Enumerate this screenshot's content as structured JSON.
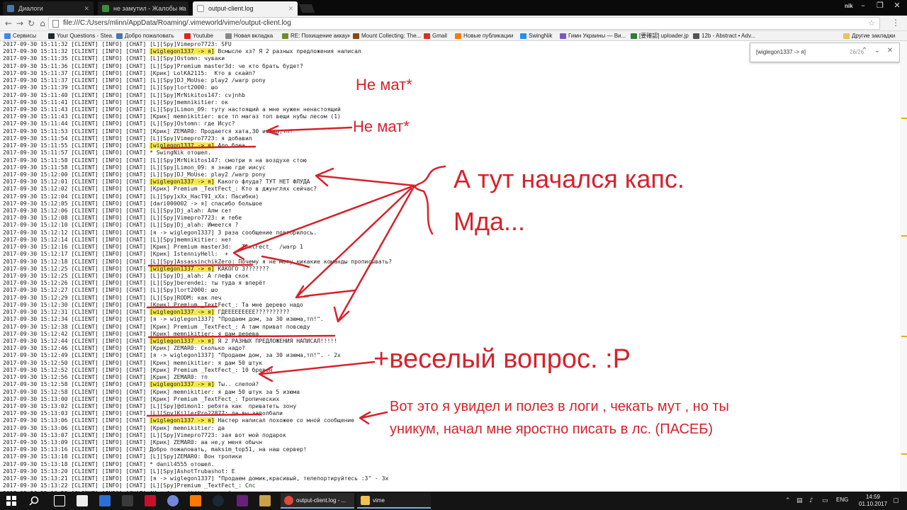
{
  "browser": {
    "tabs": [
      {
        "label": "Диалоги",
        "color": "#4a76a8"
      },
      {
        "label": "не замутил - Жалобы на ...",
        "color": "#3b8e3b"
      },
      {
        "label": "output-client.log",
        "color": "#cfcfcf"
      }
    ],
    "user": "nik",
    "window_controls": [
      "–",
      "❐",
      "✕"
    ],
    "url": "file:///C:/Users/mlinn/AppData/Roaming/.vimeworld/vime/output-client.log",
    "icons": {
      "back": "←",
      "forward": "→",
      "reload": "↻",
      "home": "⌂",
      "star": "☆",
      "menu": "⋮"
    }
  },
  "bookmarks": {
    "items": [
      {
        "label": "Сервисы",
        "color": "#4285f4"
      },
      {
        "label": "Your Questions - Stea...",
        "color": "#1b2838"
      },
      {
        "label": "Добро пожаловать",
        "color": "#4a76a8"
      },
      {
        "label": "Youtube",
        "color": "#e62117"
      },
      {
        "label": "Новая вкладка",
        "color": "#888888"
      },
      {
        "label": "RE: Похищение аккаунт...",
        "color": "#6b8e23"
      },
      {
        "label": "Mount Collecting: The...",
        "color": "#8b4513"
      },
      {
        "label": "Gmail",
        "color": "#d93025"
      },
      {
        "label": "Новые публикации",
        "color": "#f57c00"
      },
      {
        "label": "SwingNik",
        "color": "#1e90ff"
      },
      {
        "label": "Гимн Украины — Ви...",
        "color": "#7e57c2"
      },
      {
        "label": "[要確認] uploader.jp",
        "color": "#2e7d32"
      },
      {
        "label": "12b - Abstract • Adv...",
        "color": "#555555"
      }
    ],
    "other": "Другие закладки"
  },
  "find": {
    "query": "[wiglegon1337 -> я]",
    "count": "26/26",
    "up": "⌃",
    "down": "⌄",
    "close": "✕"
  },
  "log": [
    {
      "ts": "2017-09-30 15:11:32",
      "msg": " [CLIENT] [INFO] [CHAT] [L][Spy]Vimepro7723: SFU"
    },
    {
      "ts": "2017-09-30 15:11:32",
      "hl": "[wiglegon1337 -> я]",
      "msg": " Всмысле хз? Я 2 разных предложения написал"
    },
    {
      "ts": "2017-09-30 15:11:35",
      "msg": " [CLIENT] [INFO] [CHAT] [L][Spy]Ostomn: чуваки"
    },
    {
      "ts": "2017-09-30 15:11:36",
      "msg": " [CLIENT] [INFO] [CHAT] [L][Spy]Premium master3d: че кто брать будет?"
    },
    {
      "ts": "2017-09-30 15:11:37",
      "msg": " [CLIENT] [INFO] [CHAT] [Крик] LolKA2115:  Кто в скайп?"
    },
    {
      "ts": "2017-09-30 15:11:37",
      "msg": " [CLIENT] [INFO] [CHAT] [L][Spy]DJ_MoUse: play2 /warp pony"
    },
    {
      "ts": "2017-09-30 15:11:39",
      "msg": " [CLIENT] [INFO] [CHAT] [L][Spy]lort2000: шо"
    },
    {
      "ts": "2017-09-30 15:11:40",
      "msg": " [CLIENT] [INFO] [CHAT] [L][Spy]MrNikitos147: cvjnhb"
    },
    {
      "ts": "2017-09-30 15:11:41",
      "msg": " [CLIENT] [INFO] [CHAT] [L][Spy]memnikitier: ок"
    },
    {
      "ts": "2017-09-30 15:11:43",
      "msg": " [CLIENT] [INFO] [CHAT] [L][Spy]Limon_09: туту настоящий а мне нужен ненастоящий"
    },
    {
      "ts": "2017-09-30 15:11:43",
      "msg": " [CLIENT] [INFO] [CHAT] [Крик] memnikitier: все тп магаз топ вещи нубы лесом (1)"
    },
    {
      "ts": "2017-09-30 15:11:44",
      "msg": " [CLIENT] [INFO] [CHAT] [L][Spy]Ostomn: где Исус?"
    },
    {
      "ts": "2017-09-30 15:11:53",
      "msg": " [CLIENT] [INFO] [CHAT] [Крик] ZEMAR0: Продается хата,30 изюма,тп!"
    },
    {
      "ts": "2017-09-30 15:11:54",
      "msg": " [CLIENT] [INFO] [CHAT] [L][Spy]Vimepro7723: я добавил"
    },
    {
      "ts": "2017-09-30 15:11:55",
      "hl": "[wiglegon1337 -> я]",
      "msg": " Ало блеа"
    },
    {
      "ts": "2017-09-30 15:11:57",
      "msg": " [CLIENT] [INFO] [CHAT] * SwingNik отошел."
    },
    {
      "ts": "2017-09-30 15:11:58",
      "msg": " [CLIENT] [INFO] [CHAT] [L][Spy]MrNikitos147: смотри я на воздухе стою"
    },
    {
      "ts": "2017-09-30 15:11:58",
      "msg": " [CLIENT] [INFO] [CHAT] [L][Spy]Limon_09: я знаю где иисус"
    },
    {
      "ts": "2017-09-30 15:12:00",
      "msg": " [CLIENT] [INFO] [CHAT] [L][Spy]DJ_MoUse: play2 /warp pony"
    },
    {
      "ts": "2017-09-30 15:12:01",
      "hl": "[wiglegon1337 -> я]",
      "msg": " Какого флуда? ТУТ НЕТ ФЛУДА"
    },
    {
      "ts": "2017-09-30 15:12:02",
      "msg": " [CLIENT] [INFO] [CHAT] [Крик] Premium _TextFect_: Кто в джунглях сейчас?"
    },
    {
      "ts": "2017-09-30 15:12:04",
      "msg": " [CLIENT] [INFO] [CHAT] [L][Spy]xXx_НасТ9I_xXx: Пасибки)"
    },
    {
      "ts": "2017-09-30 15:12:05",
      "msg": " [CLIENT] [INFO] [CHAT] [dari000002 -> я] спасибо большое"
    },
    {
      "ts": "2017-09-30 15:12:06",
      "msg": " [CLIENT] [INFO] [CHAT] [L][Spy]Dj_alah: Алм сет"
    },
    {
      "ts": "2017-09-30 15:12:08",
      "msg": " [CLIENT] [INFO] [CHAT] [L][Spy]Vimepro7723: и тебе"
    },
    {
      "ts": "2017-09-30 15:12:10",
      "msg": " [CLIENT] [INFO] [CHAT] [L][Spy]Dj_alah: Имеется ?"
    },
    {
      "ts": "2017-09-30 15:12:12",
      "msg": " [CLIENT] [INFO] [CHAT] [я -> wiglegon1337] 3 раза сообщение повторилось."
    },
    {
      "ts": "2017-09-30 15:12:14",
      "msg": " [CLIENT] [INFO] [CHAT] [L][Spy]memnikitier: нет"
    },
    {
      "ts": "2017-09-30 15:12:16",
      "msg": " [CLIENT] [INFO] [CHAT] [Крик] Premium master3d:  _TextFect_  /warp 1"
    },
    {
      "ts": "2017-09-30 15:12:17",
      "msg": " [CLIENT] [INFO] [CHAT] [Крик] IstenniyHell:  +"
    },
    {
      "ts": "2017-09-30 15:12:18",
      "msg": " [CLIENT] [INFO] [CHAT] [L][Spy]AssassinchikZero: Почему я не могу никакие команды прописывать?"
    },
    {
      "ts": "2017-09-30 15:12:25",
      "hl": "[wiglegon1337 -> я]",
      "msg": " КАКОГО З???????"
    },
    {
      "ts": "2017-09-30 15:12:25",
      "msg": " [CLIENT] [INFO] [CHAT] [L][Spy]Dj_alah: А глефа скок"
    },
    {
      "ts": "2017-09-30 15:12:26",
      "msg": " [CLIENT] [INFO] [CHAT] [L][Spy]berendei: ты туда я вперёт"
    },
    {
      "ts": "2017-09-30 15:12:27",
      "msg": " [CLIENT] [INFO] [CHAT] [L][Spy]lort2000: шо"
    },
    {
      "ts": "2017-09-30 15:12:29",
      "msg": " [CLIENT] [INFO] [CHAT] [L][Spy]RODM: как леч"
    },
    {
      "ts": "2017-09-30 15:12:30",
      "msg": " [CLIENT] [INFO] [CHAT] [Крик] Premium _TextFect_: Та мне дерево надо"
    },
    {
      "ts": "2017-09-30 15:12:31",
      "hl": "[wiglegon1337 -> я]",
      "msg": " ГДЕЕЕЕЕЕЕЕЕ??????????"
    },
    {
      "ts": "2017-09-30 15:12:34",
      "msg": " [CLIENT] [INFO] [CHAT] [я -> wiglegon1337] \"Продаем дом, за 30 изюма,тп!\"."
    },
    {
      "ts": "2017-09-30 15:12:38",
      "msg": " [CLIENT] [INFO] [CHAT] [Крик] Premium _TextFect_: А там приват повсюду"
    },
    {
      "ts": "2017-09-30 15:12:42",
      "msg": " [CLIENT] [INFO] [CHAT] [Крик] memnikitier: я дам дерева"
    },
    {
      "ts": "2017-09-30 15:12:44",
      "hl": "[wiglegon1337 -> я]",
      "msg": " Я 2 РАЗНЫХ ПРЕДЛОЖЕНИЯ НАПИСАЛ!!!!!"
    },
    {
      "ts": "2017-09-30 15:12:46",
      "msg": " [CLIENT] [INFO] [CHAT] [Крик] ZEMAR0: Сколько надо?"
    },
    {
      "ts": "2017-09-30 15:12:49",
      "msg": " [CLIENT] [INFO] [CHAT] [я -> wiglegon1337] \"Продаем дом, за 30 изюма,тп!\". - 2x"
    },
    {
      "ts": "2017-09-30 15:12:50",
      "msg": " [CLIENT] [INFO] [CHAT] [Крик] memnikitier: я дам 50 штук"
    },
    {
      "ts": "2017-09-30 15:12:52",
      "msg": " [CLIENT] [INFO] [CHAT] [Крик] Premium _TextFect_: 10 бревен"
    },
    {
      "ts": "2017-09-30 15:12:56",
      "msg": " [CLIENT] [INFO] [CHAT] [Крик] ZEMAR0: тп"
    },
    {
      "ts": "2017-09-30 15:12:58",
      "hl": "[wiglegon1337 -> я]",
      "msg": " Ты.. слепой?"
    },
    {
      "ts": "2017-09-30 15:12:58",
      "msg": " [CLIENT] [INFO] [CHAT] [Крик] memnikitier: я дам 50 штук за 5 изюма"
    },
    {
      "ts": "2017-09-30 15:13:00",
      "msg": " [CLIENT] [INFO] [CHAT] [Крик] Premium _TextFect_: Тропических"
    },
    {
      "ts": "2017-09-30 15:13:02",
      "msg": " [CLIENT] [INFO] [CHAT] [L][Spy]@dimon1: ребята как  приватеть зону"
    },
    {
      "ts": "2017-09-30 15:13:03",
      "msg": " [CLIENT] [INFO] [CHAT] [L][Spy]KillerPro22877: да вы задолбали"
    },
    {
      "ts": "2017-09-30 15:13:06",
      "hl": "[wiglegon1337 -> я]",
      "msg": " Настер написал похожее со мной сообщение"
    },
    {
      "ts": "2017-09-30 15:13:06",
      "msg": " [CLIENT] [INFO] [CHAT] [Крик] memnikitier: да"
    },
    {
      "ts": "2017-09-30 15:13:07",
      "msg": " [CLIENT] [INFO] [CHAT] [L][Spy]Vimepro7723: зая вот мой подарок"
    },
    {
      "ts": "2017-09-30 15:13:09",
      "msg": " [CLIENT] [INFO] [CHAT] [Крик] ZEMAR0: аа не,у меня обычн"
    },
    {
      "ts": "2017-09-30 15:13:16",
      "msg": " [CLIENT] [INFO] [CHAT] Добро пожаловать, maksim_top51, на наш сервер!"
    },
    {
      "ts": "2017-09-30 15:13:18",
      "msg": " [CLIENT] [INFO] [CHAT] [L][Spy]ZEMAR0: Вон тропики"
    },
    {
      "ts": "2017-09-30 15:13:18",
      "msg": " [CLIENT] [INFO] [CHAT] * danil4555 отошел."
    },
    {
      "ts": "2017-09-30 15:13:20",
      "msg": " [CLIENT] [INFO] [CHAT] [L][Spy]AshotTrubashot: Е"
    },
    {
      "ts": "2017-09-30 15:13:21",
      "msg": " [CLIENT] [INFO] [CHAT] [я -> wiglegon1337] \"Продаем домик,красивый, телепортируйтесь :3\" - 3x"
    },
    {
      "ts": "2017-09-30 15:13:22",
      "msg": " [CLIENT] [INFO] [CHAT] [L][Spy]Premium _TextFect_: Спс"
    },
    {
      "ts": "2017-09-30 15:13:22",
      "msg": " [CLIENT] [INFO] [CHAT] [Крик] memnikitier: стой"
    },
    {
      "ts": "2017-09-30 15:13:22",
      "msg": " [CLIENT] [INFO] [CHAT] [L][Spy]xXx_НасТ9I_xXx: Спасибки)"
    }
  ],
  "hl_prefix": " [CLIENT] [INFO] [CHAT] ",
  "annotations": {
    "ne_mat_1": "Не мат*",
    "ne_mat_2": "Не мат*",
    "caps_1": "А тут начался капс.",
    "caps_2": "Мда...",
    "question": "+веселый вопрос. :Р",
    "saw_1": "Вот это я увидел и полез в логи , чекать мут , но ты",
    "saw_2": "уникум, начал мне яростно писать в лс.    (ПАСЕБ)",
    "color": "#d6222b"
  },
  "taskbar": {
    "tasks": [
      {
        "label": "output-client.log - ...",
        "color": "#dd4b39"
      },
      {
        "label": "vime",
        "color": "#f2c14e"
      }
    ],
    "lang": "ENG",
    "time": "14:59",
    "date": "01.10.2017"
  }
}
